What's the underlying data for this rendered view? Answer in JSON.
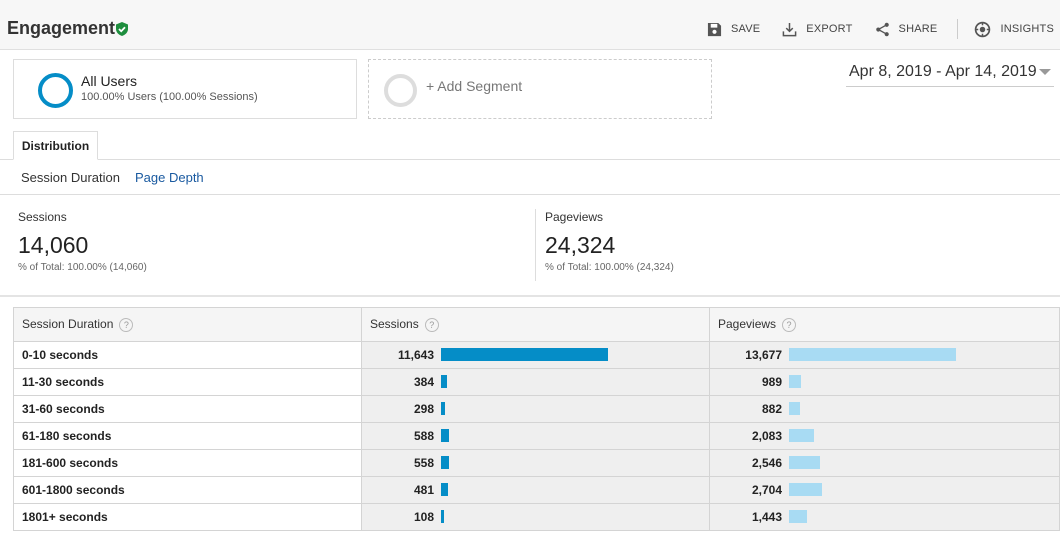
{
  "header": {
    "title": "Engagement",
    "save_label": "SAVE",
    "export_label": "EXPORT",
    "share_label": "SHARE",
    "insights_label": "INSIGHTS"
  },
  "segments": {
    "active": {
      "name": "All Users",
      "sub": "100.00% Users (100.00% Sessions)",
      "color": "#058dc7"
    },
    "add_label": "+ Add Segment"
  },
  "date_range": "Apr 8, 2019 - Apr 14, 2019",
  "tabs": {
    "active": "Distribution"
  },
  "subnav": {
    "session_duration": "Session Duration",
    "page_depth": "Page Depth"
  },
  "metrics": {
    "sessions": {
      "label": "Sessions",
      "value": "14,060",
      "sub": "% of Total: 100.00% (14,060)"
    },
    "pageviews": {
      "label": "Pageviews",
      "value": "24,324",
      "sub": "% of Total: 100.00% (24,324)"
    }
  },
  "table": {
    "headers": {
      "dimension": "Session Duration",
      "sessions": "Sessions",
      "pageviews": "Pageviews"
    },
    "help_glyph": "?",
    "rows": [
      {
        "label": "0-10 seconds",
        "sessions": "11,643",
        "sessions_value": 11643,
        "pageviews": "13,677",
        "pageviews_value": 13677
      },
      {
        "label": "11-30 seconds",
        "sessions": "384",
        "sessions_value": 384,
        "pageviews": "989",
        "pageviews_value": 989
      },
      {
        "label": "31-60 seconds",
        "sessions": "298",
        "sessions_value": 298,
        "pageviews": "882",
        "pageviews_value": 882
      },
      {
        "label": "61-180 seconds",
        "sessions": "588",
        "sessions_value": 588,
        "pageviews": "2,083",
        "pageviews_value": 2083
      },
      {
        "label": "181-600 seconds",
        "sessions": "558",
        "sessions_value": 558,
        "pageviews": "2,546",
        "pageviews_value": 2546
      },
      {
        "label": "601-1800 seconds",
        "sessions": "481",
        "sessions_value": 481,
        "pageviews": "2,704",
        "pageviews_value": 2704
      },
      {
        "label": "1801+ seconds",
        "sessions": "108",
        "sessions_value": 108,
        "pageviews": "1,443",
        "pageviews_value": 1443
      }
    ],
    "colors": {
      "sessions_bar": "#058dc7",
      "pageviews_bar": "#a8dbf3"
    }
  },
  "icons": [
    "verified-shield-icon",
    "save-icon",
    "export-icon",
    "share-icon",
    "insights-icon",
    "chevron-down-icon",
    "help-icon"
  ]
}
